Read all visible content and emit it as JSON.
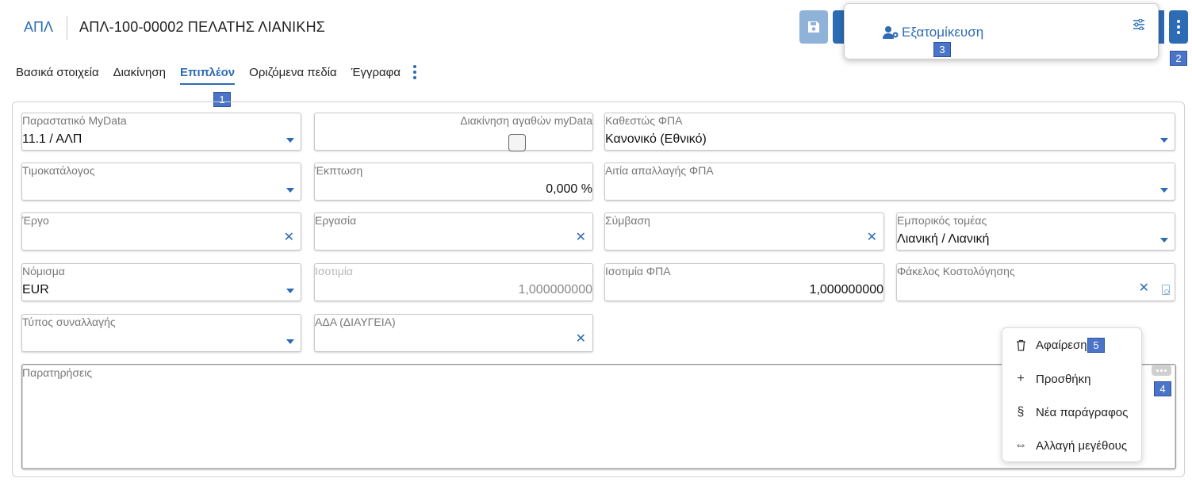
{
  "header": {
    "code": "ΑΠΛ",
    "title": "ΑΠΛ-100-00002 ΠΕΛΑΤΗΣ ΛΙΑΝΙΚΗΣ"
  },
  "popup": {
    "label": "Εξατομίκευση"
  },
  "badges": {
    "b1": "1",
    "b2": "2",
    "b3": "3",
    "b4": "4",
    "b5": "5"
  },
  "tabs": [
    {
      "label": "Βασικά στοιχεία"
    },
    {
      "label": "Διακίνηση"
    },
    {
      "label": "Επιπλέον",
      "active": true
    },
    {
      "label": "Οριζόμενα πεδία"
    },
    {
      "label": "Έγγραφα"
    }
  ],
  "fields": {
    "mydata_doc": {
      "label": "Παραστατικό MyData",
      "value": "11.1 / ΑΛΠ"
    },
    "mydata_goods": {
      "label": "Διακίνηση αγαθών myData"
    },
    "vat_status": {
      "label": "Καθεστώς ΦΠΑ",
      "value": "Κανονικό (Εθνικό)"
    },
    "pricelist": {
      "label": "Τιμοκατάλογος",
      "value": ""
    },
    "discount": {
      "label": "Έκπτωση",
      "value": "0,000 %"
    },
    "vat_exempt_reason": {
      "label": "Αιτία απαλλαγής ΦΠΑ",
      "value": ""
    },
    "project": {
      "label": "Έργο",
      "value": ""
    },
    "task": {
      "label": "Εργασία",
      "value": ""
    },
    "contract": {
      "label": "Σύμβαση",
      "value": ""
    },
    "business_sector": {
      "label": "Εμπορικός τομέας",
      "value": "Λιανική / Λιανική"
    },
    "currency": {
      "label": "Νόμισμα",
      "value": "EUR"
    },
    "exchange_rate": {
      "label": "Ισοτιμία",
      "value": "1,000000000"
    },
    "vat_exchange_rate": {
      "label": "Ισοτιμία ΦΠΑ",
      "value": "1,000000000"
    },
    "costing_folder": {
      "label": "Φάκελος Κοστολόγησης",
      "value": ""
    },
    "transaction_type": {
      "label": "Τύπος συναλλαγής",
      "value": ""
    },
    "ada": {
      "label": "ΑΔΑ (ΔΙΑΥΓΕΙΑ)",
      "value": ""
    },
    "notes": {
      "label": "Παρατηρήσεις",
      "value": ""
    }
  },
  "context_menu": {
    "remove": "Αφαίρεση",
    "add": "Προσθήκη",
    "new_paragraph": "Νέα παράγραφος",
    "resize": "Αλλαγή μεγέθους"
  }
}
